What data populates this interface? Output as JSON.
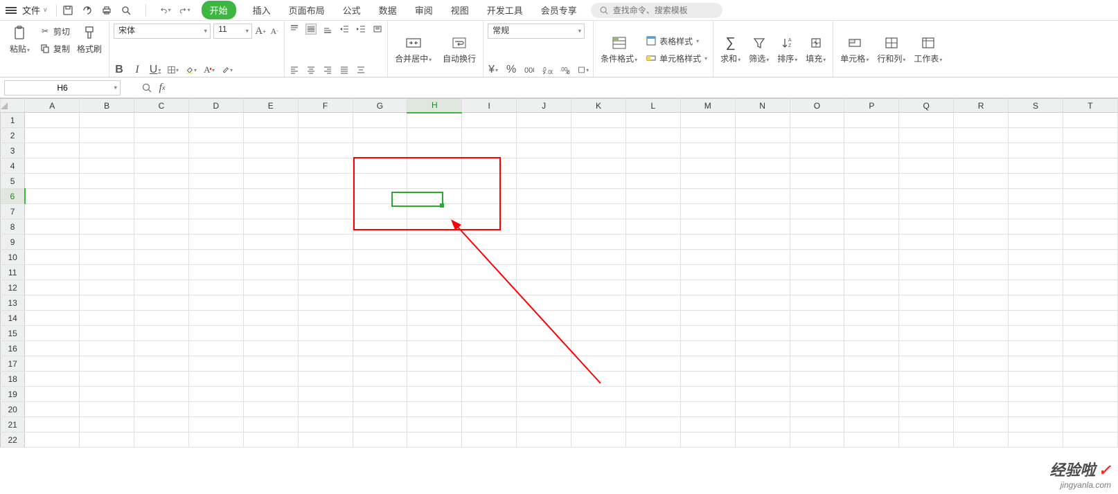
{
  "menu": {
    "file_label": "文件",
    "tabs": [
      "开始",
      "插入",
      "页面布局",
      "公式",
      "数据",
      "审阅",
      "视图",
      "开发工具",
      "会员专享"
    ],
    "active_tab_index": 0,
    "search_placeholder": "查找命令、搜索模板"
  },
  "qat_icons": [
    "save-icon",
    "save-as-icon",
    "print-icon",
    "print-preview-icon",
    "undo-icon",
    "redo-icon"
  ],
  "ribbon": {
    "clipboard": {
      "paste": "粘贴",
      "cut": "剪切",
      "copy": "复制",
      "format_painter": "格式刷"
    },
    "font": {
      "name": "宋体",
      "size": "11",
      "increase_font_tip": "A",
      "decrease_font_tip": "A"
    },
    "alignment": {
      "merge_center": "合并居中",
      "wrap_text": "自动换行"
    },
    "number": {
      "format": "常规",
      "percent_tip": "%"
    },
    "styles": {
      "cond_format": "条件格式",
      "table_style": "表格样式",
      "cell_style": "单元格样式"
    },
    "editing": {
      "sum": "求和",
      "filter": "筛选",
      "sort": "排序",
      "fill": "填充"
    },
    "cells": {
      "cell": "单元格",
      "row_col": "行和列",
      "worksheet": "工作表"
    }
  },
  "formula_bar": {
    "name_box": "H6",
    "fx_value": ""
  },
  "grid": {
    "columns": [
      "A",
      "B",
      "C",
      "D",
      "E",
      "F",
      "G",
      "H",
      "I",
      "J",
      "K",
      "L",
      "M",
      "N",
      "O",
      "P",
      "Q",
      "R",
      "S",
      "T"
    ],
    "rows": [
      1,
      2,
      3,
      4,
      5,
      6,
      7,
      8,
      9,
      10,
      11,
      12,
      13,
      14,
      15,
      16,
      17,
      18,
      19,
      20,
      21,
      22
    ],
    "active_col": "H",
    "active_row": 6
  },
  "watermark": {
    "line1": "经验啦",
    "line2": "jingyanla.com"
  }
}
